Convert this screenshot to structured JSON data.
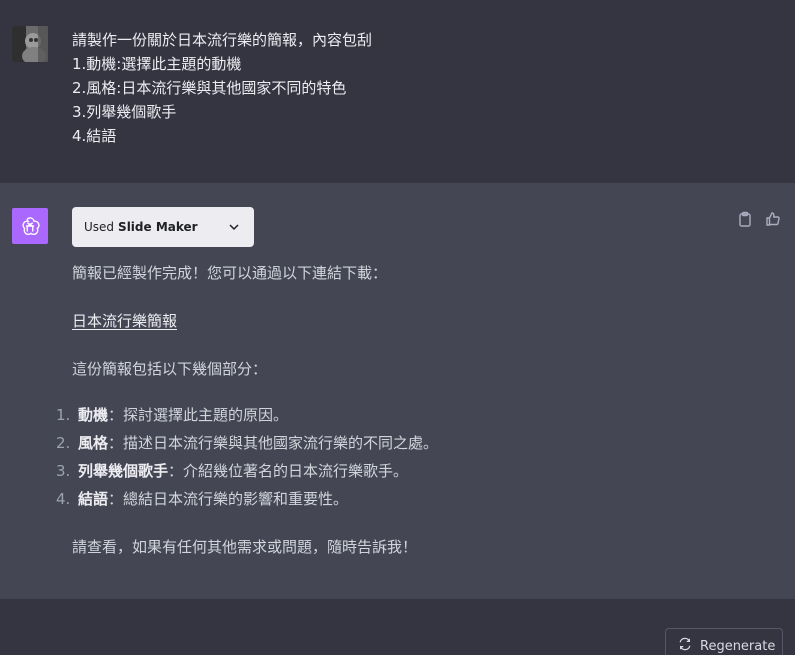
{
  "user_message": {
    "lines": [
      "請製作一份關於日本流行樂的簡報，內容包刮",
      "1.動機:選擇此主題的動機",
      "2.風格:日本流行樂與其他國家不同的特色",
      "3.列舉幾個歌手",
      "4.結語"
    ]
  },
  "assistant": {
    "plugin": {
      "used_label": "Used",
      "plugin_name": "Slide Maker"
    },
    "intro": "簡報已經製作完成！您可以通過以下連結下載：",
    "link_text": "日本流行樂簡報",
    "sections_intro": "這份簡報包括以下幾個部分：",
    "items": [
      {
        "num": "1.",
        "term": "動機",
        "desc": "：探討選擇此主題的原因。"
      },
      {
        "num": "2.",
        "term": "風格",
        "desc": "：描述日本流行樂與其他國家流行樂的不同之處。"
      },
      {
        "num": "3.",
        "term": "列舉幾個歌手",
        "desc": "：介紹幾位著名的日本流行樂歌手。"
      },
      {
        "num": "4.",
        "term": "結語",
        "desc": "：總結日本流行樂的影響和重要性。"
      }
    ],
    "closing": "請查看，如果有任何其他需求或問題，隨時告訴我！"
  },
  "footer": {
    "regenerate_label": "Regenerate"
  },
  "icons": {
    "bot_avatar": "openai-logo-icon",
    "copy": "clipboard-icon",
    "like": "thumbs-up-icon",
    "chevron": "chevron-down-icon",
    "regenerate": "refresh-icon"
  },
  "colors": {
    "user_bg": "#343541",
    "assistant_bg": "#444654",
    "bot_avatar_bg": "#ab68ff",
    "plugin_pill_bg": "#ececf1"
  }
}
